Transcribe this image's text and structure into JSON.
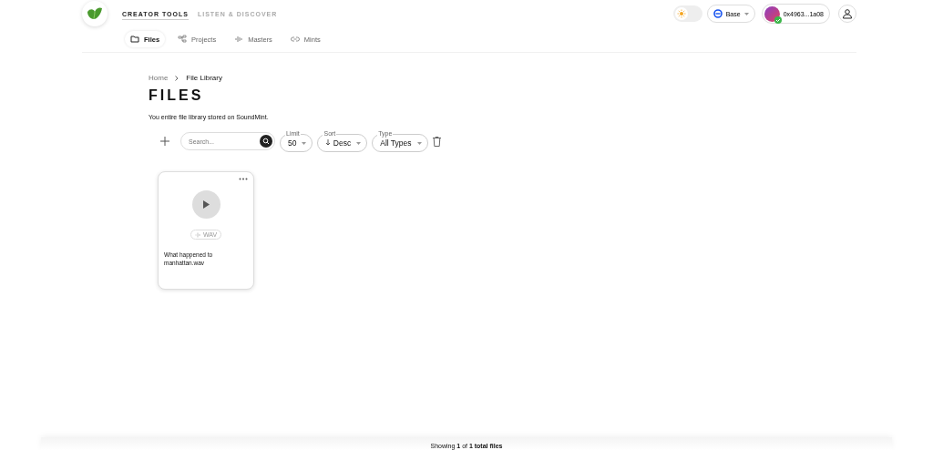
{
  "nav": {
    "sections": [
      {
        "label": "CREATOR TOOLS",
        "selected": true
      },
      {
        "label": "LISTEN & DISCOVER",
        "selected": false
      }
    ],
    "subtabs": [
      {
        "label": "Files",
        "selected": true
      },
      {
        "label": "Projects",
        "selected": false
      },
      {
        "label": "Masters",
        "selected": false
      },
      {
        "label": "Mints",
        "selected": false
      }
    ],
    "theme_toggle": {
      "on": false
    },
    "network": {
      "label": "Base"
    },
    "wallet": {
      "address": "0x4963...1a08"
    }
  },
  "breadcrumbs": [
    "Home",
    "File Library"
  ],
  "title": "FILES",
  "subtitle": "You entire file library stored on SoundMint.",
  "toolbar": {
    "search": {
      "placeholder": "Search..."
    },
    "limit": {
      "label": "Limit",
      "value": "50"
    },
    "sort": {
      "label": "Sort",
      "value": "Desc"
    },
    "type": {
      "label": "Type",
      "value": "All Types"
    }
  },
  "files": [
    {
      "name": "What happened to manhattan.wav",
      "format": "WAV"
    }
  ],
  "footer": "Showing **1** of **1 total files**"
}
